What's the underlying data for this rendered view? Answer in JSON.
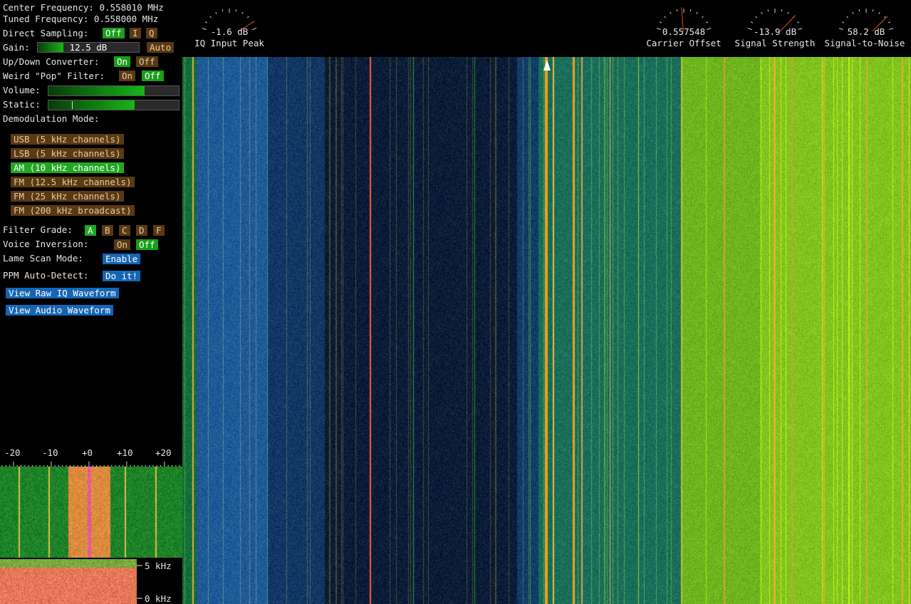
{
  "header": {
    "center_frequency": "Center Frequency: 0.558010 MHz",
    "tuned_frequency": "Tuned Frequency: 0.558000 MHz"
  },
  "controls": {
    "direct_sampling_label": "Direct Sampling:",
    "direct_sampling_off": "Off",
    "direct_sampling_i": "I",
    "direct_sampling_q": "Q",
    "gain_label": "Gain:",
    "gain_value": "12.5 dB",
    "gain_auto": "Auto",
    "updown_label": "Up/Down Converter:",
    "updown_on": "On",
    "updown_off": "Off",
    "pop_label": "Weird \"Pop\" Filter:",
    "pop_on": "On",
    "pop_off": "Off",
    "volume_label": "Volume:",
    "volume_level": 0.74,
    "static_label": "Static:",
    "static_level": 0.66,
    "demod_label": "Demodulation Mode:",
    "demod_modes": [
      "USB (5 kHz channels)",
      "LSB (5 kHz channels)",
      "AM (10 kHz channels)",
      "FM (12.5 kHz channels)",
      "FM (25 kHz channels)",
      "FM (200 kHz broadcast)"
    ],
    "filter_grade_label": "Filter Grade:",
    "filter_grades": [
      "A",
      "B",
      "C",
      "D",
      "F"
    ],
    "voice_inversion_label": "Voice Inversion:",
    "voice_inversion_on": "On",
    "voice_inversion_off": "Off",
    "lame_scan_label": "Lame Scan Mode:",
    "lame_scan_button": "Enable",
    "ppm_label": "PPM Auto-Detect:",
    "ppm_button": "Do it!",
    "view_raw_iq": "View Raw IQ Waveform",
    "view_audio": "View Audio Waveform"
  },
  "meters": [
    {
      "value": "-1.6 dB",
      "caption": "IQ Input Peak",
      "needle": 0.9
    },
    {
      "value": "0.557548",
      "caption": "Carrier Offset",
      "needle": 0.47
    },
    {
      "value": "-13.9 dB",
      "caption": "Signal Strength",
      "needle": 0.8
    },
    {
      "value": "58.2 dB",
      "caption": "Signal-to-Noise",
      "needle": 0.82
    }
  ],
  "mini_scale": {
    "ticks": [
      "-20",
      "-10",
      "+0",
      "+10",
      "+20"
    ]
  },
  "audio_scale": {
    "top": "5 kHz",
    "bottom": "0 kHz"
  },
  "colors": {
    "on_green": "#1a9e1a",
    "off_brown": "#5a3a12",
    "button_blue": "#1565b5",
    "tuning_line": "#ff5a3c"
  }
}
